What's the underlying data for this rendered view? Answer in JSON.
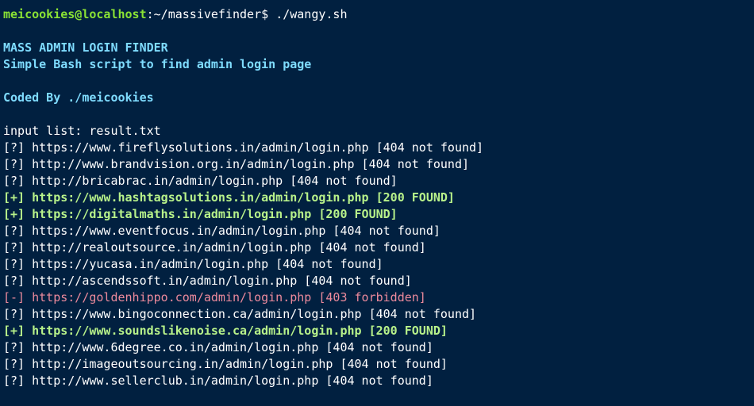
{
  "prompt": {
    "user_host": "meicookies@localhost",
    "path": ":~/massivefinder",
    "symbol": "$ ",
    "command": "./wangy.sh"
  },
  "banner": {
    "title": "MASS ADMIN LOGIN FINDER",
    "subtitle": "Simple Bash script to find admin login page",
    "credit": "Coded By ./meicookies"
  },
  "input_list": "input list: result.txt",
  "results": [
    {
      "text": "[?] https://www.fireflysolutions.in/admin/login.php [404 not found]",
      "status": "notfound"
    },
    {
      "text": "[?] http://www.brandvision.org.in/admin/login.php [404 not found]",
      "status": "notfound"
    },
    {
      "text": "[?] http://bricabrac.in/admin/login.php [404 not found]",
      "status": "notfound"
    },
    {
      "text": "[+] https://www.hashtagsolutions.in/admin/login.php [200 FOUND]",
      "status": "found"
    },
    {
      "text": "[+] https://digitalmaths.in/admin/login.php [200 FOUND]",
      "status": "found"
    },
    {
      "text": "[?] https://www.eventfocus.in/admin/login.php [404 not found]",
      "status": "notfound"
    },
    {
      "text": "[?] http://realoutsource.in/admin/login.php [404 not found]",
      "status": "notfound"
    },
    {
      "text": "[?] https://yucasa.in/admin/login.php [404 not found]",
      "status": "notfound"
    },
    {
      "text": "[?] http://ascendssoft.in/admin/login.php [404 not found]",
      "status": "notfound"
    },
    {
      "text": "[-] https://goldenhippo.com/admin/login.php [403 forbidden]",
      "status": "forbidden"
    },
    {
      "text": "[?] https://www.bingoconnection.ca/admin/login.php [404 not found]",
      "status": "notfound"
    },
    {
      "text": "[+] https://www.soundslikenoise.ca/admin/login.php [200 FOUND]",
      "status": "found"
    },
    {
      "text": "[?] http://www.6degree.co.in/admin/login.php [404 not found]",
      "status": "notfound"
    },
    {
      "text": "[?] http://imageoutsourcing.in/admin/login.php [404 not found]",
      "status": "notfound"
    },
    {
      "text": "[?] http://www.sellerclub.in/admin/login.php [404 not found]",
      "status": "notfound"
    }
  ],
  "colors": {
    "background": "#012040",
    "prompt_user": "#8ae234",
    "banner": "#7fdcff",
    "found": "#b8f28a",
    "forbidden": "#ec8a9c",
    "default": "#ffffff"
  }
}
